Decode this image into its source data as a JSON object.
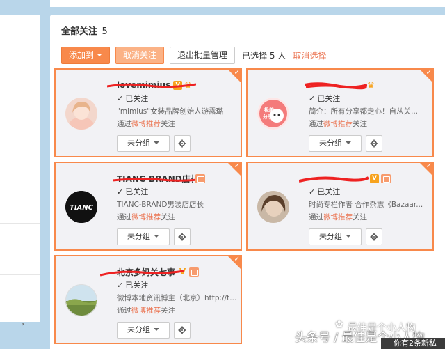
{
  "header": {
    "title": "全部关注",
    "count": "5"
  },
  "toolbar": {
    "add_to_label": "添加到",
    "unfollow_label": "取消关注",
    "exit_batch_label": "退出批量管理",
    "selected_text": "已选择 5 人",
    "cancel_selection_label": "取消选择"
  },
  "cards": [
    {
      "name": "lovemimius",
      "status": "已关注",
      "desc": "\"mimius\"女装品牌创始人游露璐",
      "via_prefix": "通过",
      "via_source": "微博推荐",
      "via_suffix": "关注",
      "group": "未分组",
      "badges": [
        "V",
        "crown"
      ]
    },
    {
      "name": "",
      "status": "已关注",
      "desc": "简介：所有分享都走心！自从关...",
      "via_prefix": "通过",
      "via_source": "微博推荐",
      "via_suffix": "关注",
      "group": "未分组",
      "badges": [
        "crown"
      ]
    },
    {
      "name": "TIANC-BRAND店长",
      "status": "已关注",
      "desc": "TIANC-BRAND男装店店长",
      "via_prefix": "通过",
      "via_source": "微博推荐",
      "via_suffix": "关注",
      "group": "未分组",
      "badges": [
        "member"
      ]
    },
    {
      "name": "",
      "status": "已关注",
      "desc": "时尚专栏作者 合作杂志《Bazaar...",
      "via_prefix": "通过",
      "via_source": "微博推荐",
      "via_suffix": "关注",
      "group": "未分组",
      "badges": [
        "V",
        "member"
      ]
    },
    {
      "name": "北京多妈关七事",
      "status": "已关注",
      "desc": "微博本地资讯博主（北京）http://t...",
      "via_prefix": "通过",
      "via_source": "微博推荐",
      "via_suffix": "关注",
      "group": "未分组",
      "badges": [
        "V",
        "member"
      ]
    }
  ],
  "avatars": {
    "card2_text": "极美\n分享",
    "card3_text": "TIANC"
  },
  "watermark": {
    "main": "头条号 / 最佳是个小人物",
    "secondary": "最佳是个小人物"
  },
  "notification": {
    "text": "你有2条新私"
  },
  "colors": {
    "accent": "#f8894b",
    "link": "#eb7350",
    "background": "#b9d6ea",
    "verified": "#f7a31e"
  }
}
